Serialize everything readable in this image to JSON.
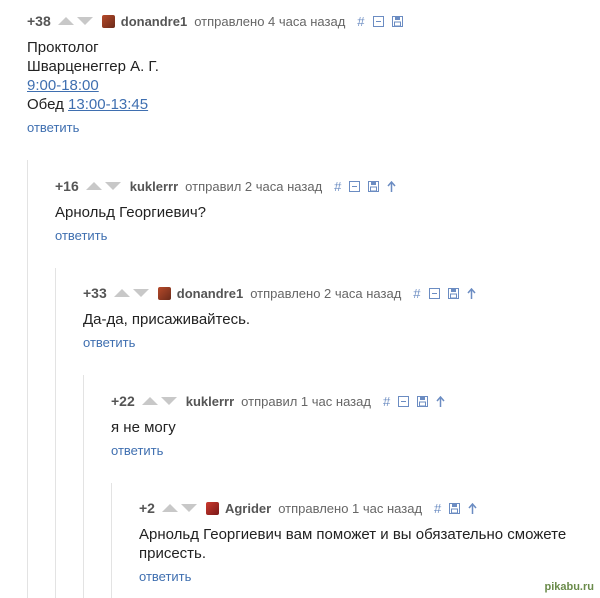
{
  "comments": [
    {
      "rating": "+38",
      "user": "donandre1",
      "time": "отправлено 4 часа назад",
      "lines": [
        "Проктолог",
        "Шварценеггер А. Г."
      ],
      "hours": "9:00-18:00",
      "lunch_label": "Обед",
      "lunch_time": "13:00-13:45",
      "reply": "ответить"
    },
    {
      "rating": "+16",
      "user": "kuklerrr",
      "time": "отправил 2 часа назад",
      "text": "Арнольд Георгиевич?",
      "reply": "ответить"
    },
    {
      "rating": "+33",
      "user": "donandre1",
      "time": "отправлено 2 часа назад",
      "text": "Да-да, присаживайтесь.",
      "reply": "ответить"
    },
    {
      "rating": "+22",
      "user": "kuklerrr",
      "time": "отправил 1 час назад",
      "text": "я не могу",
      "reply": "ответить"
    },
    {
      "rating": "+2",
      "user": "Agrider",
      "time": "отправлено 1 час назад",
      "text_line1": "Арнольд Георгиевич вам поможет и вы обязательно сможете",
      "text_line2": "присесть.",
      "reply": "ответить"
    }
  ],
  "icons": {
    "link": "#",
    "colors": {
      "link": "#3f6fb0",
      "tool": "#6b8cc2",
      "arrow": "#c8c8c8"
    }
  },
  "watermark": "pikabu.ru"
}
